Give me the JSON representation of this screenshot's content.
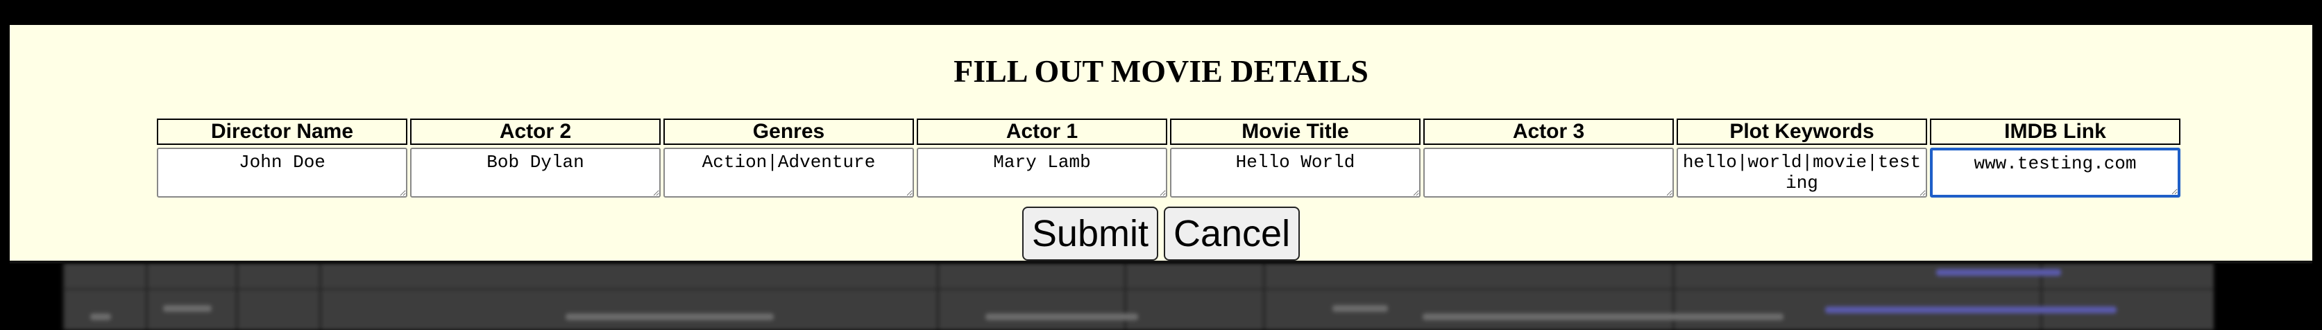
{
  "modal": {
    "title": "FILL OUT MOVIE DETAILS",
    "columns": [
      {
        "header": "Director Name",
        "value": "John Doe"
      },
      {
        "header": "Actor 2",
        "value": "Bob Dylan"
      },
      {
        "header": "Genres",
        "value": "Action|Adventure"
      },
      {
        "header": "Actor 1",
        "value": "Mary Lamb"
      },
      {
        "header": "Movie Title",
        "value": "Hello World"
      },
      {
        "header": "Actor 3",
        "value": ""
      },
      {
        "header": "Plot Keywords",
        "value": "hello|world|movie|testing"
      },
      {
        "header": "IMDB Link",
        "value": "www.testing.com"
      }
    ],
    "submit_label": "Submit",
    "cancel_label": "Cancel"
  },
  "colors": {
    "modal_background": "#ffffe6",
    "focus_border": "#1f5fc8",
    "backdrop": "#3d3d3d"
  }
}
